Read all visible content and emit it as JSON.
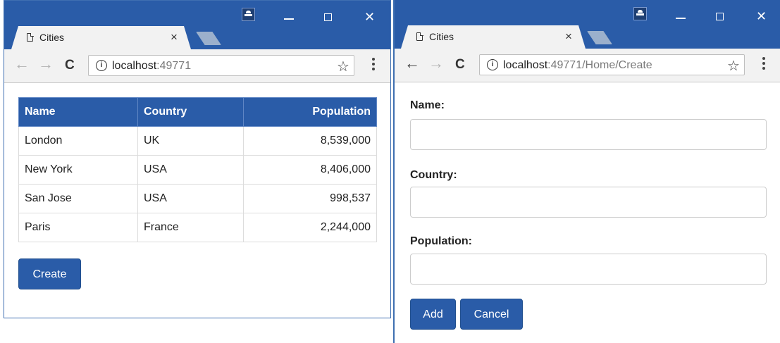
{
  "left_window": {
    "tab_title": "Cities",
    "tab_close": "×",
    "url_host": "localhost",
    "url_rest": ":49771",
    "table": {
      "headers": [
        "Name",
        "Country",
        "Population"
      ],
      "rows": [
        [
          "London",
          "UK",
          "8,539,000"
        ],
        [
          "New York",
          "USA",
          "8,406,000"
        ],
        [
          "San Jose",
          "USA",
          "998,537"
        ],
        [
          "Paris",
          "France",
          "2,244,000"
        ]
      ]
    },
    "create_button": "Create"
  },
  "right_window": {
    "tab_title": "Cities",
    "tab_close": "×",
    "url_host": "localhost",
    "url_rest": ":49771/Home/Create",
    "form": {
      "name_label": "Name:",
      "country_label": "Country:",
      "population_label": "Population:",
      "name_value": "",
      "country_value": "",
      "population_value": ""
    },
    "add_button": "Add",
    "cancel_button": "Cancel"
  },
  "chrome": {
    "back_icon": "←",
    "forward_icon": "→",
    "reload_icon": "C",
    "info_icon": "i",
    "star_icon": "☆",
    "close_icon": "✕"
  },
  "colors": {
    "title_bar": "#2a5ca8",
    "button": "#2a5ca8",
    "table_header": "#2a5ca8"
  }
}
